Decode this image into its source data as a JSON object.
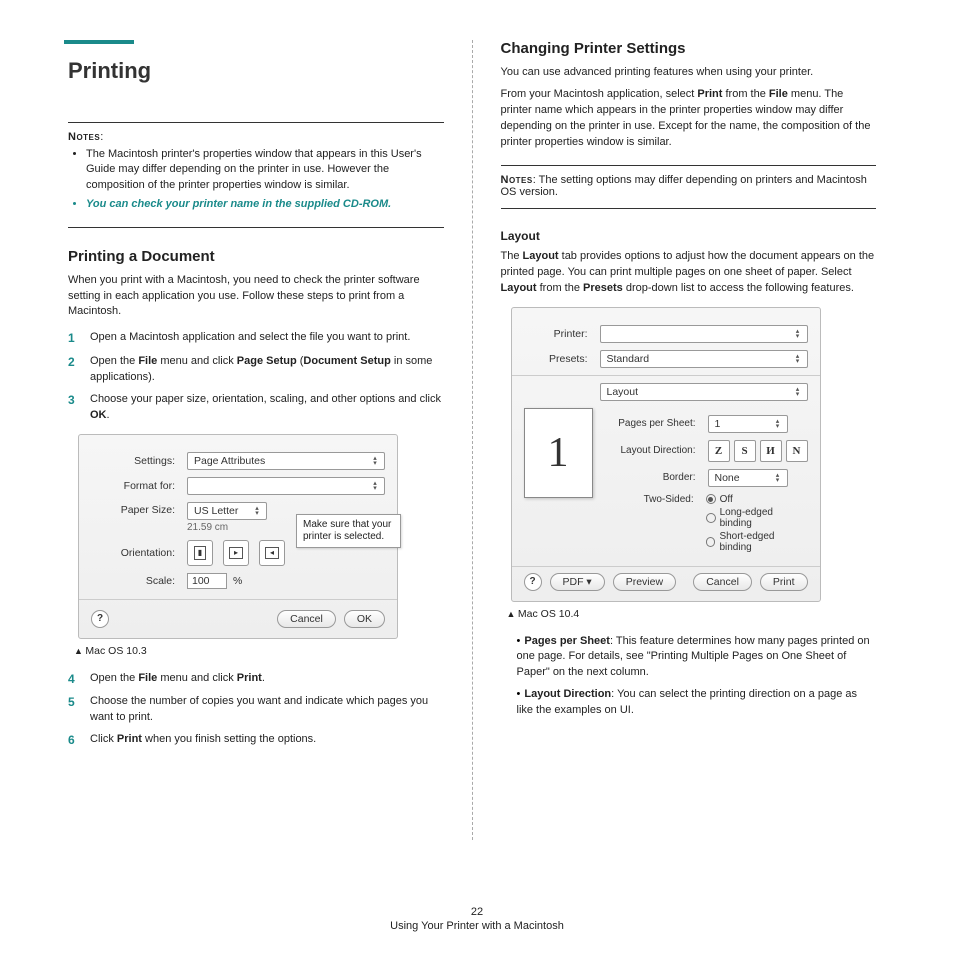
{
  "left": {
    "title": "Printing",
    "notes_label": "Notes",
    "notes": [
      "The Macintosh printer's properties window that appears in this User's Guide may differ depending on the printer in use. However the composition of the printer properties window is similar."
    ],
    "notes_teal": "You can check your printer name in the supplied CD-ROM.",
    "h2": "Printing a Document",
    "intro": "When you print with a Macintosh, you need to check the printer software setting in each application you use. Follow these steps to print from a Macintosh.",
    "steps_a": [
      {
        "n": "1",
        "t1": "Open a Macintosh application and select the file you want to print."
      },
      {
        "n": "2",
        "t1": "Open the ",
        "b1": "File",
        "t2": " menu and click ",
        "b2": "Page Setup",
        "t3": " (",
        "b3": "Document Setup",
        "t4": " in some applications)."
      },
      {
        "n": "3",
        "t1": "Choose your paper size, orientation, scaling, and other options and click ",
        "b1": "OK",
        "t2": "."
      }
    ],
    "dlg1": {
      "settings_lbl": "Settings:",
      "settings_val": "Page Attributes",
      "format_lbl": "Format for:",
      "paper_lbl": "Paper Size:",
      "paper_val": "US Letter",
      "paper_dim": "21.59 cm",
      "orient_lbl": "Orientation:",
      "scale_lbl": "Scale:",
      "scale_val": "100",
      "scale_unit": "%",
      "help": "?",
      "cancel": "Cancel",
      "ok": "OK",
      "callout": "Make sure that your printer is selected."
    },
    "caption1": "Mac OS 10.3",
    "steps_b": [
      {
        "n": "4",
        "t1": "Open the ",
        "b1": "File",
        "t2": " menu and click ",
        "b2": "Print",
        "t3": "."
      },
      {
        "n": "5",
        "t1": "Choose the number of copies you want and indicate which pages you want to print."
      },
      {
        "n": "6",
        "t1": "Click ",
        "b1": "Print",
        "t2": " when you finish setting the options."
      }
    ]
  },
  "right": {
    "h2": "Changing Printer Settings",
    "p1": "You can use advanced printing features when using your printer.",
    "p2a": "From your Macintosh application, select ",
    "p2b": "Print",
    "p2c": " from the ",
    "p2d": "File",
    "p2e": " menu. The printer name which appears in the printer properties window may differ depending on the printer in use. Except for the name, the composition of the printer properties window is similar.",
    "notes_label": "Notes",
    "notes_text": ": The setting options may differ depending on printers and Macintosh OS version.",
    "h3": "Layout",
    "layout_p_a": "The ",
    "layout_p_b": "Layout",
    "layout_p_c": " tab provides options to adjust how the document appears on the printed page. You can print multiple pages on one sheet of paper. Select ",
    "layout_p_d": "Layout",
    "layout_p_e": " from the ",
    "layout_p_f": "Presets",
    "layout_p_g": " drop-down list to access the following features.",
    "dlg2": {
      "printer_lbl": "Printer:",
      "presets_lbl": "Presets:",
      "presets_val": "Standard",
      "panel_val": "Layout",
      "pps_lbl": "Pages per Sheet:",
      "pps_val": "1",
      "dir_lbl": "Layout Direction:",
      "border_lbl": "Border:",
      "border_val": "None",
      "two_lbl": "Two-Sided:",
      "two_off": "Off",
      "two_long": "Long-edged binding",
      "two_short": "Short-edged binding",
      "preview_big": "1",
      "help": "?",
      "pdf": "PDF ▾",
      "preview": "Preview",
      "cancel": "Cancel",
      "print": "Print"
    },
    "caption2": "Mac OS 10.4",
    "bullets": [
      {
        "b": "Pages per Sheet",
        "t": ": This feature determines how many pages printed on one page. For details, see \"Printing Multiple Pages on One Sheet of Paper\" on the next column."
      },
      {
        "b": "Layout Direction",
        "t": ": You can select the printing direction on a page as like the examples on UI."
      }
    ]
  },
  "footer": {
    "page": "22",
    "text": "Using Your Printer with a Macintosh"
  }
}
